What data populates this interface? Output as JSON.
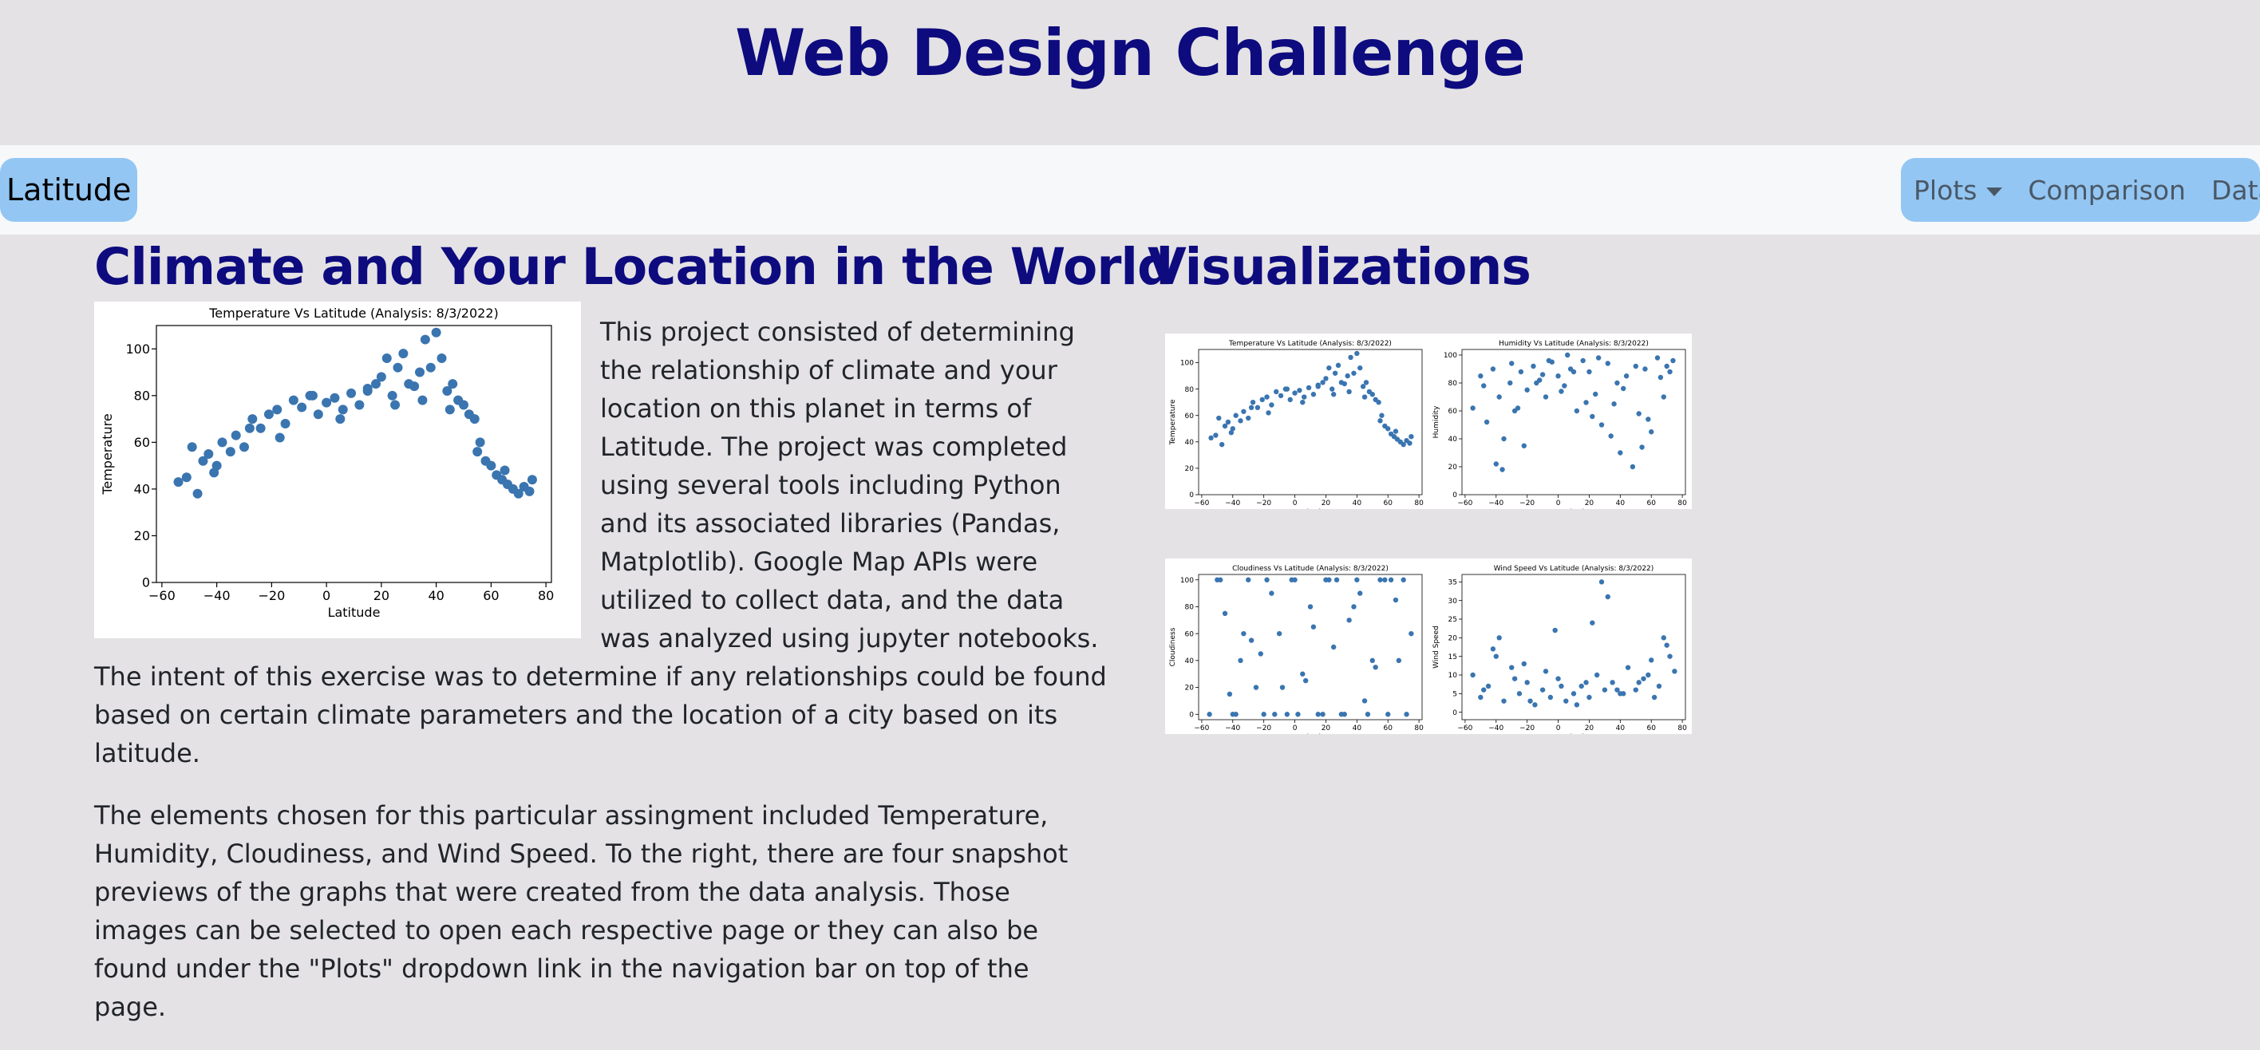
{
  "header": {
    "title": "Web Design Challenge"
  },
  "navbar": {
    "brand": "Latitude",
    "links": {
      "plots": "Plots",
      "comparison": "Comparison",
      "data": "Data"
    }
  },
  "left": {
    "heading": "Climate and Your Location in the World",
    "paragraph1": "This project consisted of determining the relationship of climate and your location on this planet in terms of Latitude. The project was completed using several tools including Python and its associated libraries (Pandas, Matplotlib). Google Map APIs were utilized to collect data, and the data was analyzed using jupyter notebooks. The intent of this exercise was to determine if any relationships could be found based on certain climate parameters and the location of a city based on its latitude.",
    "paragraph2": "The elements chosen for this particular assingment included Temperature, Humidity, Cloudiness, and Wind Speed. To the right, there are four snapshot previews of the graphs that were created from the data analysis. Those images can be selected to open each respective page or they can also be found under the \"Plots\" dropdown link in the navigation bar on top of the page."
  },
  "right": {
    "heading": "Visualizations"
  },
  "colors": {
    "point": "#3a75b0",
    "heading": "#0d0b7e",
    "nav": "#93c6f3"
  },
  "chart_data": [
    {
      "id": "temperature",
      "type": "scatter",
      "title": "Temperature Vs Latitude (Analysis: 8/3/2022)",
      "xlabel": "Latitude",
      "ylabel": "Temperature",
      "xlim": [
        -62,
        82
      ],
      "ylim": [
        0,
        110
      ],
      "xticks": [
        -60,
        -40,
        -20,
        0,
        20,
        40,
        60,
        80
      ],
      "yticks": [
        0,
        20,
        40,
        60,
        80,
        100
      ],
      "x": [
        -54,
        -51,
        -47,
        -45,
        -43,
        -41,
        -38,
        -35,
        -33,
        -30,
        -27,
        -24,
        -21,
        -18,
        -15,
        -12,
        -9,
        -6,
        -3,
        0,
        3,
        6,
        9,
        12,
        15,
        18,
        20,
        22,
        24,
        26,
        28,
        30,
        32,
        34,
        36,
        38,
        40,
        42,
        44,
        46,
        48,
        50,
        52,
        54,
        56,
        58,
        60,
        62,
        64,
        66,
        68,
        70,
        72,
        74,
        -49,
        -40,
        -28,
        -17,
        -5,
        5,
        15,
        25,
        35,
        45,
        55,
        65,
        75
      ],
      "y": [
        43,
        45,
        38,
        52,
        55,
        47,
        60,
        56,
        63,
        58,
        70,
        66,
        72,
        74,
        68,
        78,
        75,
        80,
        72,
        77,
        79,
        74,
        81,
        76,
        83,
        85,
        88,
        96,
        80,
        92,
        98,
        85,
        84,
        90,
        104,
        92,
        107,
        96,
        82,
        85,
        78,
        76,
        72,
        70,
        60,
        52,
        50,
        46,
        44,
        42,
        40,
        38,
        41,
        39,
        58,
        50,
        66,
        62,
        80,
        70,
        82,
        76,
        78,
        74,
        56,
        48,
        44
      ]
    },
    {
      "id": "humidity",
      "type": "scatter",
      "title": "Humidity Vs Latitude (Analysis: 8/3/2022)",
      "xlabel": "Latitude",
      "ylabel": "Humidity",
      "xlim": [
        -62,
        82
      ],
      "ylim": [
        0,
        104
      ],
      "xticks": [
        -60,
        -40,
        -20,
        0,
        20,
        40,
        60,
        80
      ],
      "yticks": [
        0,
        20,
        40,
        60,
        80,
        100
      ],
      "x": [
        -55,
        -50,
        -46,
        -42,
        -38,
        -35,
        -31,
        -28,
        -24,
        -20,
        -16,
        -12,
        -8,
        -4,
        0,
        4,
        8,
        12,
        16,
        20,
        24,
        28,
        32,
        36,
        40,
        44,
        48,
        52,
        56,
        60,
        64,
        68,
        72,
        -48,
        -40,
        -30,
        -22,
        -14,
        -6,
        2,
        10,
        18,
        26,
        34,
        42,
        50,
        58,
        66,
        74,
        -36,
        -26,
        -10,
        6,
        22,
        38,
        54,
        70
      ],
      "y": [
        62,
        85,
        52,
        90,
        70,
        40,
        80,
        60,
        88,
        75,
        92,
        82,
        70,
        95,
        85,
        78,
        90,
        60,
        96,
        88,
        72,
        50,
        94,
        65,
        30,
        85,
        20,
        58,
        90,
        45,
        98,
        70,
        88,
        78,
        22,
        94,
        35,
        80,
        96,
        74,
        88,
        66,
        98,
        42,
        76,
        92,
        54,
        84,
        96,
        18,
        62,
        86,
        100,
        56,
        80,
        34,
        92
      ]
    },
    {
      "id": "cloudiness",
      "type": "scatter",
      "title": "Cloudiness Vs Latitude (Analysis: 8/3/2022)",
      "xlabel": "Latitude",
      "ylabel": "Cloudiness",
      "xlim": [
        -62,
        82
      ],
      "ylim": [
        -4,
        104
      ],
      "xticks": [
        -60,
        -40,
        -20,
        0,
        20,
        40,
        60,
        80
      ],
      "yticks": [
        0,
        20,
        40,
        60,
        80,
        100
      ],
      "x": [
        -55,
        -50,
        -45,
        -40,
        -35,
        -30,
        -25,
        -20,
        -15,
        -10,
        -5,
        0,
        5,
        10,
        15,
        20,
        25,
        30,
        35,
        40,
        45,
        50,
        55,
        60,
        65,
        70,
        75,
        -48,
        -38,
        -28,
        -18,
        -8,
        2,
        12,
        22,
        32,
        42,
        52,
        62,
        72,
        -42,
        -22,
        -2,
        18,
        38,
        58,
        -33,
        -13,
        7,
        27,
        47,
        67
      ],
      "y": [
        0,
        100,
        75,
        0,
        40,
        100,
        20,
        0,
        90,
        60,
        0,
        100,
        30,
        80,
        0,
        100,
        50,
        0,
        70,
        100,
        10,
        40,
        100,
        0,
        85,
        100,
        60,
        100,
        0,
        55,
        100,
        20,
        0,
        65,
        100,
        0,
        90,
        35,
        100,
        0,
        15,
        45,
        100,
        0,
        80,
        100,
        60,
        0,
        25,
        100,
        0,
        40
      ]
    },
    {
      "id": "windspeed",
      "type": "scatter",
      "title": "Wind Speed Vs Latitude (Analysis: 8/3/2022)",
      "xlabel": "Latitude",
      "ylabel": "Wind Speed",
      "xlim": [
        -62,
        82
      ],
      "ylim": [
        -2,
        37
      ],
      "xticks": [
        -60,
        -40,
        -20,
        0,
        20,
        40,
        60,
        80
      ],
      "yticks": [
        0,
        5,
        10,
        15,
        20,
        25,
        30,
        35
      ],
      "x": [
        -55,
        -50,
        -45,
        -40,
        -35,
        -30,
        -25,
        -20,
        -15,
        -10,
        -5,
        0,
        5,
        10,
        15,
        20,
        25,
        30,
        35,
        40,
        45,
        50,
        55,
        60,
        65,
        70,
        75,
        -48,
        -38,
        -28,
        -18,
        -8,
        2,
        12,
        22,
        28,
        32,
        42,
        52,
        62,
        72,
        -42,
        -22,
        -2,
        18,
        38,
        58,
        68
      ],
      "y": [
        10,
        4,
        7,
        15,
        3,
        12,
        5,
        8,
        2,
        6,
        4,
        9,
        3,
        5,
        7,
        4,
        10,
        6,
        8,
        5,
        12,
        6,
        9,
        14,
        7,
        18,
        11,
        6,
        20,
        9,
        3,
        11,
        7,
        2,
        24,
        35,
        31,
        5,
        8,
        4,
        15,
        17,
        13,
        22,
        8,
        6,
        10,
        20
      ]
    }
  ]
}
